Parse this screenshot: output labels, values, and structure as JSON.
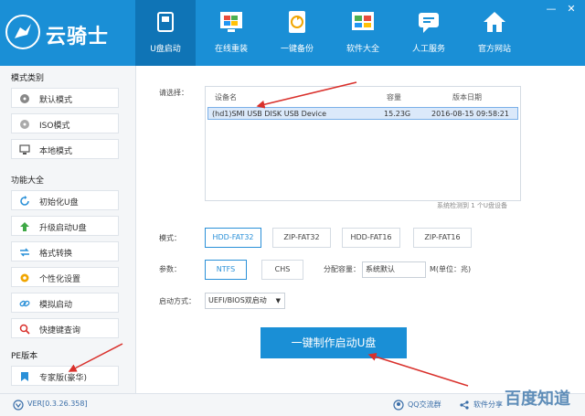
{
  "app": {
    "brand": "云骑士",
    "window_controls": [
      "—",
      "✕"
    ]
  },
  "nav": {
    "items": [
      {
        "label": "U盘启动",
        "icon": "usb-icon",
        "active": true
      },
      {
        "label": "在线重装",
        "icon": "windows-icon",
        "active": false
      },
      {
        "label": "一键备份",
        "icon": "backup-icon",
        "active": false
      },
      {
        "label": "软件大全",
        "icon": "apps-icon",
        "active": false
      },
      {
        "label": "人工服务",
        "icon": "chat-icon",
        "active": false
      },
      {
        "label": "官方网站",
        "icon": "home-icon",
        "active": false
      }
    ]
  },
  "sidebar": {
    "mode_title": "模式类别",
    "modes": [
      {
        "label": "默认模式",
        "icon": "disc-icon"
      },
      {
        "label": "ISO模式",
        "icon": "cd-icon"
      },
      {
        "label": "本地模式",
        "icon": "monitor-icon"
      }
    ],
    "func_title": "功能大全",
    "funcs": [
      {
        "label": "初始化U盘",
        "icon": "refresh-icon"
      },
      {
        "label": "升级启动U盘",
        "icon": "up-arrow-icon"
      },
      {
        "label": "格式转换",
        "icon": "swap-icon"
      },
      {
        "label": "个性化设置",
        "icon": "settings-icon"
      },
      {
        "label": "模拟启动",
        "icon": "link-icon"
      },
      {
        "label": "快捷键查询",
        "icon": "search-icon"
      }
    ],
    "pe_title": "PE版本",
    "pe_items": [
      {
        "label": "专家版(豪华)",
        "icon": "bookmark-icon"
      }
    ]
  },
  "main": {
    "device_label": "请选择：",
    "table": {
      "columns": [
        "设备名",
        "容量",
        "版本日期"
      ],
      "rows": [
        {
          "name": "(hd1)SMI USB DISK USB Device",
          "capacity": "15.23G",
          "date": "2016-08-15 09:58:21"
        }
      ],
      "status": "系统检测到 1 个U盘设备"
    },
    "mode_label": "模式：",
    "modes": [
      "HDD-FAT32",
      "ZIP-FAT32",
      "HDD-FAT16",
      "ZIP-FAT16"
    ],
    "selected_mode": "HDD-FAT32",
    "param_label": "参数：",
    "fs_options": [
      "NTFS",
      "CHS"
    ],
    "selected_fs": "NTFS",
    "partition_label": "分配容量：",
    "partition_value": "系统默认",
    "unit_label": "M(单位：兆)",
    "boot_label": "启动方式：",
    "boot_value": "UEFI/BIOS双启动",
    "make_button": "一键制作启动U盘"
  },
  "footer": {
    "version": "VER[0.3.26.358]",
    "qq": "QQ交流群",
    "share": "软件分享"
  },
  "watermark": "百度知道",
  "colors": {
    "header_blue": "#1a8fd6",
    "active_tab": "#0f74b6",
    "accent_red": "#d9302b"
  }
}
